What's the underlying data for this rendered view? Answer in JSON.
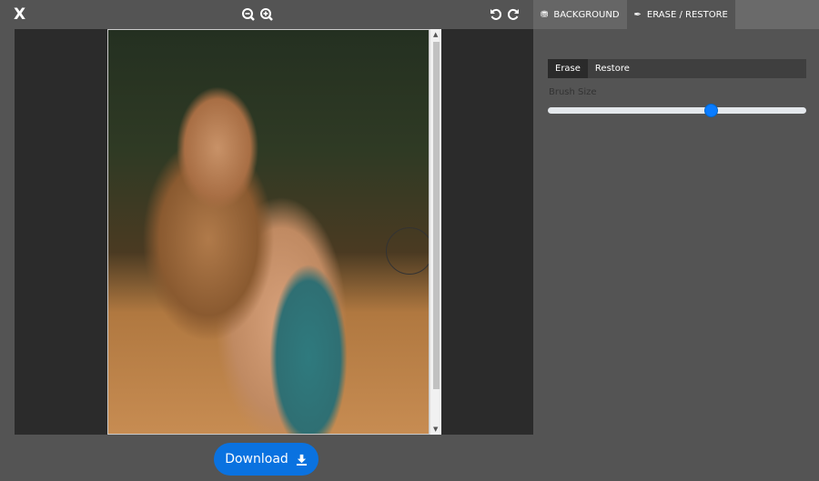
{
  "toolbar": {
    "close_label": "X"
  },
  "tabs": [
    {
      "label": "BACKGROUND",
      "icon": "database-icon"
    },
    {
      "label": "ERASE / RESTORE",
      "icon": "brush-icon",
      "active": true
    }
  ],
  "panel": {
    "modes": [
      "Erase",
      "Restore"
    ],
    "active_mode": "Erase",
    "brush_label": "Brush Size",
    "brush_value": 0.63
  },
  "download_label": "Download",
  "colors": {
    "accent": "#0a72e0",
    "slider_knob": "#0a7cff"
  }
}
